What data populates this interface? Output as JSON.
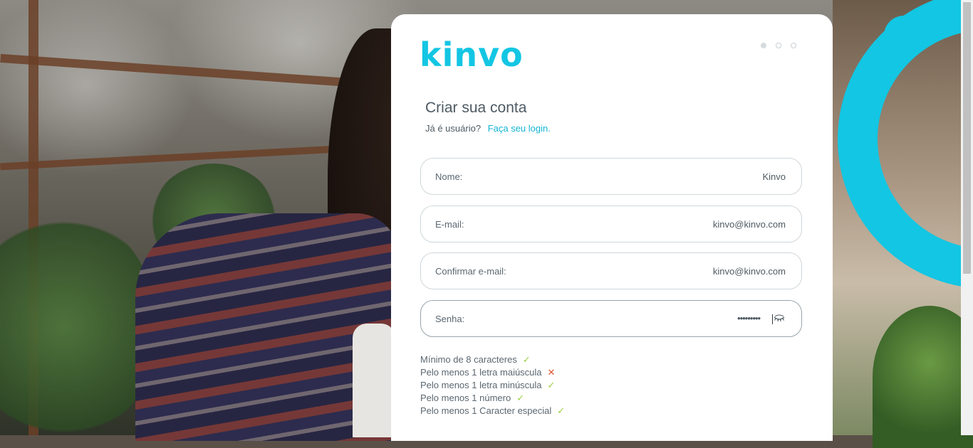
{
  "brand": {
    "logo_text": "kinvo",
    "accent_color": "#13c6e3"
  },
  "steps": {
    "total": 3,
    "current": 1
  },
  "form": {
    "title": "Criar sua conta",
    "login_prompt": "Já é usuário?",
    "login_link": "Faça seu login.",
    "fields": {
      "name": {
        "label": "Nome:",
        "value": "Kinvo"
      },
      "email": {
        "label": "E-mail:",
        "value": "kinvo@kinvo.com"
      },
      "email_confirm": {
        "label": "Confirmar e-mail:",
        "value": "kinvo@kinvo.com"
      },
      "password": {
        "label": "Senha:",
        "value": "•••••••••"
      }
    }
  },
  "password_rules": [
    {
      "text": "Mínimo de 8 caracteres",
      "status": "ok",
      "mark": "✓"
    },
    {
      "text": "Pelo menos 1 letra maiúscula",
      "status": "bad",
      "mark": "✕"
    },
    {
      "text": "Pelo menos 1 letra minúscula",
      "status": "ok",
      "mark": "✓"
    },
    {
      "text": "Pelo menos 1 número",
      "status": "ok",
      "mark": "✓"
    },
    {
      "text": "Pelo menos 1 Caracter especial",
      "status": "ok",
      "mark": "✓"
    }
  ],
  "colors": {
    "valid": "#9bcf45",
    "invalid": "#e0532f",
    "link": "#13b5d4"
  }
}
